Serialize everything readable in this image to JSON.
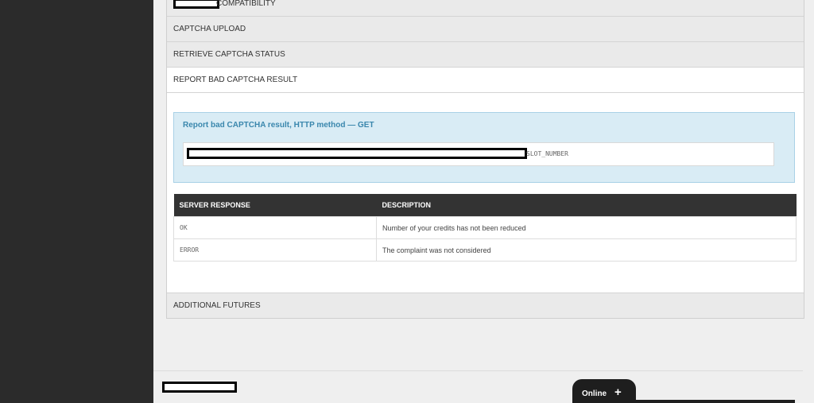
{
  "accordion": {
    "items": [
      {
        "label": "COMPATIBILITY"
      },
      {
        "label": "CAPTCHA UPLOAD"
      },
      {
        "label": "RETRIEVE CAPTCHA STATUS"
      },
      {
        "label": "REPORT BAD CAPTCHA RESULT"
      },
      {
        "label": "ADDITIONAL FUTURES"
      }
    ]
  },
  "report": {
    "title": "Report bad CAPTCHA result, HTTP method — GET",
    "url_param": "SLOT_NUMBER",
    "table": {
      "headers": [
        "SERVER RESPONSE",
        "DESCRIPTION"
      ],
      "rows": [
        {
          "code": "OK",
          "description": "Number of your credits has not been reduced"
        },
        {
          "code": "ERROR",
          "description": "The complaint was not considered"
        }
      ]
    }
  },
  "chat": {
    "label": "Online",
    "plus": "+"
  },
  "colors": {
    "sidebar": "#2b2b2b",
    "info_bg": "#d9ecf5",
    "info_title": "#3a87ad",
    "table_header": "#333333"
  }
}
